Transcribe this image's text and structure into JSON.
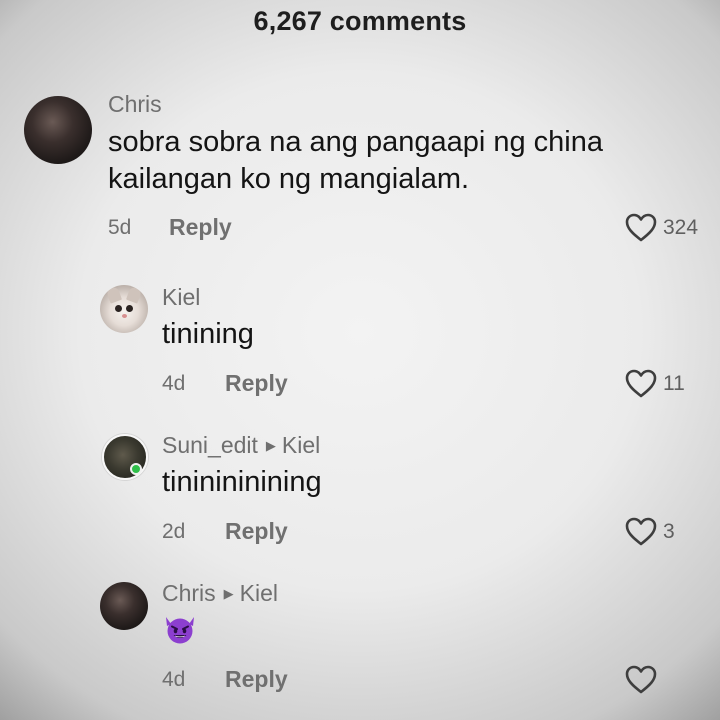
{
  "header": {
    "title": "6,267 comments"
  },
  "comments": [
    {
      "username": "Chris",
      "text_lines": [
        "sobra sobra na ang pangaapi ng china",
        "kailangan ko ng mangialam."
      ],
      "age": "5d",
      "reply_label": "Reply",
      "likes": "324"
    },
    {
      "username": "Kiel",
      "text": "tinining",
      "age": "4d",
      "reply_label": "Reply",
      "likes": "11"
    },
    {
      "username": "Suni_edit",
      "reply_to": "Kiel",
      "text": "tininininining",
      "age": "2d",
      "reply_label": "Reply",
      "likes": "3"
    },
    {
      "username": "Chris",
      "reply_to": "Kiel",
      "emoji": "smiling-face-with-horns",
      "age": "4d",
      "reply_label": "Reply",
      "likes": ""
    }
  ],
  "colors": {
    "emoji_purple": "#8c3fcf",
    "online_dot": "#2fbf4a"
  }
}
